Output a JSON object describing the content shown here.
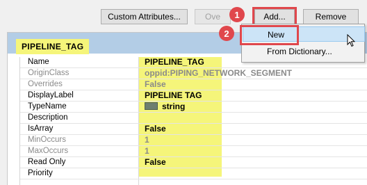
{
  "toolbar": {
    "custom_attributes": "Custom Attributes...",
    "overlay": "Ove",
    "add": "Add...",
    "remove": "Remove"
  },
  "badges": {
    "step1": "1",
    "step2": "2"
  },
  "menu": {
    "new": "New",
    "from_dictionary": "From Dictionary..."
  },
  "section": {
    "title": "PIPELINE_TAG"
  },
  "properties": [
    {
      "label": "Name",
      "value": "PIPELINE_TAG",
      "dim": false
    },
    {
      "label": "OriginClass",
      "value": "oppid:PIPING_NETWORK_SEGMENT",
      "dim": true
    },
    {
      "label": "Overrides",
      "value": "False",
      "dim": true
    },
    {
      "label": "DisplayLabel",
      "value": "PIPELINE TAG",
      "dim": false
    },
    {
      "label": "TypeName",
      "value": "string",
      "dim": false
    },
    {
      "label": "Description",
      "value": "",
      "dim": false
    },
    {
      "label": "IsArray",
      "value": "False",
      "dim": false
    },
    {
      "label": "MinOccurs",
      "value": "1",
      "dim": true
    },
    {
      "label": "MaxOccurs",
      "value": "1",
      "dim": true
    },
    {
      "label": "Read Only",
      "value": "False",
      "dim": false
    },
    {
      "label": "Priority",
      "value": "",
      "dim": false
    }
  ],
  "colors": {
    "highlight": "#f5f57a",
    "callout": "#e0474c",
    "header": "#b3cde6",
    "menu_selected": "#cce4f7"
  },
  "icons": {
    "type": "string-type-icon",
    "cursor": "mouse-pointer-icon"
  }
}
